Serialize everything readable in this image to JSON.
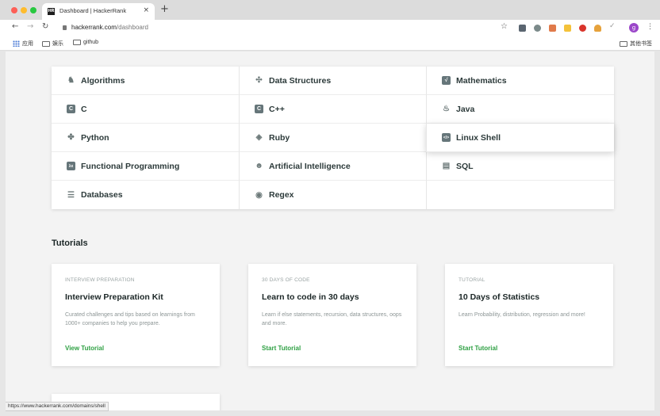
{
  "browser": {
    "tab_title": "Dashboard | HackerRank",
    "tab_favicon": "HR",
    "tab_close": "×",
    "new_tab": "+",
    "url_host": "hackerrank.com",
    "url_path": "/dashboard",
    "profile_initial": "g",
    "bookmarks": [
      "应用",
      "娱乐",
      "github"
    ],
    "other_bookmarks": "其他书签"
  },
  "domains": [
    {
      "label": "Algorithms",
      "icon": "algorithms-icon"
    },
    {
      "label": "Data Structures",
      "icon": "data-structures-icon"
    },
    {
      "label": "Mathematics",
      "icon": "mathematics-icon"
    },
    {
      "label": "C",
      "icon": "c-icon"
    },
    {
      "label": "C++",
      "icon": "cpp-icon"
    },
    {
      "label": "Java",
      "icon": "java-icon"
    },
    {
      "label": "Python",
      "icon": "python-icon"
    },
    {
      "label": "Ruby",
      "icon": "ruby-icon"
    },
    {
      "label": "Linux Shell",
      "icon": "linux-shell-icon"
    },
    {
      "label": "Functional Programming",
      "icon": "functional-programming-icon"
    },
    {
      "label": "Artificial Intelligence",
      "icon": "artificial-intelligence-icon"
    },
    {
      "label": "SQL",
      "icon": "sql-icon"
    },
    {
      "label": "Databases",
      "icon": "databases-icon"
    },
    {
      "label": "Regex",
      "icon": "regex-icon"
    }
  ],
  "tutorials": {
    "heading": "Tutorials",
    "cards": [
      {
        "kicker": "INTERVIEW PREPARATION",
        "title": "Interview Preparation Kit",
        "description": "Curated challenges and tips based on learnings from 1000+ companies to help you prepare.",
        "link": "View Tutorial"
      },
      {
        "kicker": "30 DAYS OF CODE",
        "title": "Learn to code in 30 days",
        "description": "Learn if else statements, recursion, data structures, oops and more.",
        "link": "Start Tutorial"
      },
      {
        "kicker": "TUTORIAL",
        "title": "10 Days of Statistics",
        "description": "Learn Probability, distribution, regression and more!",
        "link": "Start Tutorial"
      }
    ]
  },
  "status_url": "https://www.hackerrank.com/domains/shell",
  "colors": {
    "accent_link": "#2ea043",
    "text_dark": "#2c3a3a"
  }
}
